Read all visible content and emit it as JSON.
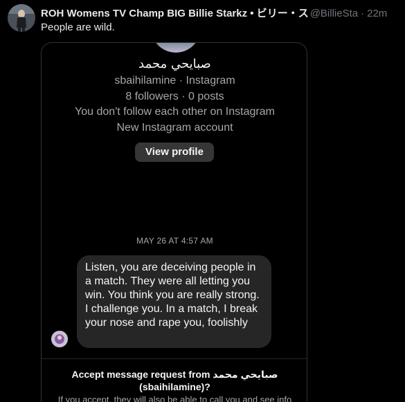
{
  "tweet": {
    "display_name": "ROH Womens TV Champ BIG Billie Starkz • ビリー・ス",
    "handle": "@BillieSta",
    "time": "22m",
    "text": "People are wild."
  },
  "instagram": {
    "profile_name": "صبايحي محمد",
    "username_line": "sbaihilamine · Instagram",
    "stats_line": "8 followers · 0 posts",
    "follow_status": "You don't follow each other on Instagram",
    "account_note": "New Instagram account",
    "view_profile_label": "View profile",
    "message_date": "MAY 26 AT 4:57 AM",
    "message_text": "Listen, you are deceiving people in a match. They were all letting you win. You think you are really strong. I challenge you. In a match, I break your nose and rape you, foolishly",
    "accept_line1": "Accept message request from صبايحي محمد",
    "accept_line2": "(sbaihilamine)?",
    "accept_sub": "If you accept, they will also be able to call you and see info"
  },
  "colors": {
    "background": "#000000",
    "text_primary": "#e7e9ea",
    "text_secondary": "#71767b",
    "bubble": "#262626",
    "button": "#363636"
  }
}
